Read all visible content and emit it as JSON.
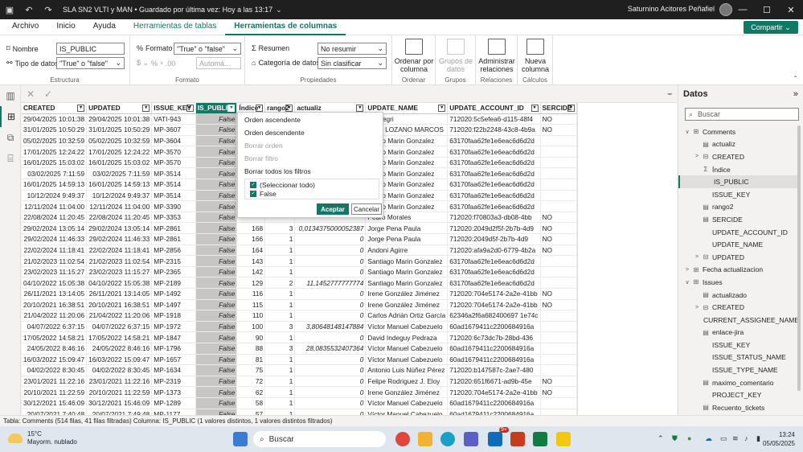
{
  "window": {
    "title": "SLA SN2 VLTI y MAN • Guardado por última vez: Hoy a las 13:17",
    "chevron": "⌄",
    "user": "Saturnino Acitores Peñafiel"
  },
  "menu": {
    "tabs": [
      "Archivo",
      "Inicio",
      "Ayuda"
    ],
    "ctx_tabs": [
      "Herramientas de tablas",
      "Herramientas de columnas"
    ],
    "active": "Herramientas de columnas",
    "share": "Compartir"
  },
  "ribbon": {
    "estructura": {
      "label": "Estructura",
      "name_label": "Nombre",
      "name_value": "IS_PUBLIC",
      "type_label": "Tipo de datos",
      "type_value": "\"True\" o \"false\""
    },
    "formato": {
      "label": "Formato",
      "format_label": "Formato",
      "format_value": "\"True\" o \"false\"",
      "auto": "Automá..."
    },
    "propiedades": {
      "label": "Propiedades",
      "summary_label": "Resumen",
      "summary_value": "No resumir",
      "category_label": "Categoría de datos",
      "category_value": "Sin clasificar"
    },
    "ordenar": {
      "label": "Ordenar",
      "btn": "Ordenar por columna"
    },
    "grupos": {
      "label": "Grupos",
      "btn": "Grupos de datos"
    },
    "relaciones": {
      "label": "Relaciones",
      "btn": "Administrar relaciones"
    },
    "calculos": {
      "label": "Cálculos",
      "btn": "Nueva columna"
    }
  },
  "table": {
    "columns": [
      "CREATED",
      "UPDATED",
      "ISSUE_KEY",
      "IS_PUBLIC",
      "Índice",
      "rango2",
      "actualiz",
      "UPDATE_NAME",
      "UPDATE_ACCOUNT_ID",
      "SERCIDE"
    ],
    "rows": [
      [
        "29/04/2025 10:01:38",
        "29/04/2025 10:01:38",
        "VATI-943",
        "False",
        "",
        "",
        "",
        "t-fpelegri",
        "712020:5c5efea6-d115-48f4",
        "NO"
      ],
      [
        "31/01/2025 10:50:29",
        "31/01/2025 10:50:29",
        "MP-3607",
        "False",
        "",
        "",
        "",
        "VIER LOZANO MARCOS",
        "712020:f22b2248-43c8-4b9a",
        "NO"
      ],
      [
        "05/02/2025 10:32:59",
        "05/02/2025 10:32:59",
        "MP-3604",
        "False",
        "",
        "",
        "",
        "ntiago Marin Gonzalez",
        "63170faa62fe1e6eac6d6d2d",
        ""
      ],
      [
        "17/01/2025 12:24:22",
        "17/01/2025 12:24:22",
        "MP-3570",
        "False",
        "",
        "",
        "",
        "ntiago Marin Gonzalez",
        "63170faa62fe1e6eac6d6d2d",
        ""
      ],
      [
        "16/01/2025 15:03:02",
        "16/01/2025 15:03:02",
        "MP-3570",
        "False",
        "",
        "",
        "",
        "ntiago Marin Gonzalez",
        "63170faa62fe1e6eac6d6d2d",
        ""
      ],
      [
        "03/02/2025 7:11:59",
        "03/02/2025 7:11:59",
        "MP-3514",
        "False",
        "",
        "",
        "",
        "ntiago Marin Gonzalez",
        "63170faa62fe1e6eac6d6d2d",
        ""
      ],
      [
        "16/01/2025 14:59:13",
        "16/01/2025 14:59:13",
        "MP-3514",
        "False",
        "",
        "",
        "",
        "ntiago Marin Gonzalez",
        "63170faa62fe1e6eac6d6d2d",
        ""
      ],
      [
        "10/12/2024 9:49:37",
        "10/12/2024 9:49:37",
        "MP-3514",
        "False",
        "",
        "",
        "",
        "ntiago Marin Gonzalez",
        "63170faa62fe1e6eac6d6d2d",
        ""
      ],
      [
        "12/11/2024 11:04:00",
        "12/11/2024 11:04:00",
        "MP-3390",
        "False",
        "",
        "",
        "",
        "ntiago Marin Gonzalez",
        "63170faa62fe1e6eac6d6d2d",
        ""
      ],
      [
        "22/08/2024 11:20:45",
        "22/08/2024 11:20:45",
        "MP-3353",
        "False",
        "",
        "",
        "",
        "Pedro Morales",
        "712020:f70803a3-db08-4bb",
        "NO"
      ],
      [
        "29/02/2024 13:05:14",
        "29/02/2024 13:05:14",
        "MP-2861",
        "False",
        "168",
        "3",
        "0,0134375000052387",
        "Jorge Pena Paula",
        "712020:2049d2f5f-2b7b-4d9",
        "NO"
      ],
      [
        "29/02/2024 11:46:33",
        "29/02/2024 11:46:33",
        "MP-2861",
        "False",
        "166",
        "1",
        "0",
        "Jorge Pena Paula",
        "712020:2049d5f-2b7b-4d9",
        "NO"
      ],
      [
        "22/02/2024 11:18:41",
        "22/02/2024 11:18:41",
        "MP-2856",
        "False",
        "164",
        "1",
        "0",
        "Andoni Agirre",
        "712020:afa9a2d0-6779-4b2a",
        "NO"
      ],
      [
        "21/02/2023 11:02:54",
        "21/02/2023 11:02:54",
        "MP-2315",
        "False",
        "143",
        "1",
        "0",
        "Santiago Marin Gonzalez",
        "63170faa62fe1e6eac6d6d2d",
        ""
      ],
      [
        "23/02/2023 11:15:27",
        "23/02/2023 11:15:27",
        "MP-2365",
        "False",
        "142",
        "1",
        "0",
        "Santiago Marin Gonzalez",
        "63170faa62fe1e6eac6d6d2d",
        ""
      ],
      [
        "04/10/2022 15:05:38",
        "04/10/2022 15:05:38",
        "MP-2189",
        "False",
        "129",
        "2",
        "11,1452777777774",
        "Santiago Marin Gonzalez",
        "63170faa62fe1e6eac6d6d2d",
        ""
      ],
      [
        "26/11/2021 13:14:05",
        "26/11/2021 13:14:05",
        "MP-1492",
        "False",
        "116",
        "1",
        "0",
        "Irene González Jiménez",
        "712020:704e5174-2a2e-41bb",
        "NO"
      ],
      [
        "20/10/2021 16:38:51",
        "20/10/2021 16:38:51",
        "MP-1497",
        "False",
        "115",
        "1",
        "0",
        "Irene González Jiménez",
        "712020:704e5174-2a2e-41bb",
        "NO"
      ],
      [
        "21/04/2022 11:20:06",
        "21/04/2022 11:20:06",
        "MP-1918",
        "False",
        "110",
        "1",
        "0",
        "Carlos Adrián Ortiz García",
        "62346a2f6a682400697 1e74c",
        ""
      ],
      [
        "04/07/2022 6:37:15",
        "04/07/2022 6:37:15",
        "MP-1972",
        "False",
        "100",
        "3",
        "3,80648148147884",
        "Víctor Manuel Cabezuelo",
        "60ad1679411c2200684916a",
        ""
      ],
      [
        "17/05/2022 14:58:21",
        "17/05/2022 14:58:21",
        "MP-1847",
        "False",
        "90",
        "1",
        "0",
        "David Indeguy Pedraza",
        "712020:6c73dc7b-28bd-436",
        ""
      ],
      [
        "24/05/2022 8:46:16",
        "24/05/2022 8:46:16",
        "MP-1796",
        "False",
        "88",
        "3",
        "28,0835532407364",
        "Víctor Manuel Cabezuelo",
        "60ad1679411c2200684916a",
        ""
      ],
      [
        "16/03/2022 15:09:47",
        "16/03/2022 15:09:47",
        "MP-1657",
        "False",
        "81",
        "1",
        "0",
        "Víctor Manuel Cabezuelo",
        "60ad1679411c2200684916a",
        ""
      ],
      [
        "04/02/2022 8:30:45",
        "04/02/2022 8:30:45",
        "MP-1634",
        "False",
        "75",
        "1",
        "0",
        "Antonio Luis Núñez Pérez",
        "712020:b147587c-2ae7-480",
        ""
      ],
      [
        "23/01/2021 11:22:16",
        "23/01/2021 11:22:16",
        "MP-2319",
        "False",
        "72",
        "1",
        "0",
        "Felipe Rodriguez J. Eloy",
        "712020:651f6671-ad9b-45e",
        "NO"
      ],
      [
        "20/10/2021 11:22:59",
        "20/10/2021 11:22:59",
        "MP-1373",
        "False",
        "62",
        "1",
        "0",
        "Irene González Jiménez",
        "712020:704e5174-2a2e-41bb",
        "NO"
      ],
      [
        "30/12/2021 15:46:09",
        "30/12/2021 15:46:09",
        "MP-1289",
        "False",
        "58",
        "1",
        "0",
        "Víctor Manuel Cabezuelo",
        "60ad1679411c2200684916a",
        ""
      ],
      [
        "20/07/2021 7:40:48",
        "20/07/2021 7:49:48",
        "MP-1177",
        "False",
        "57",
        "1",
        "0",
        "Víctor Manuel Cabezuelo",
        "60ad1679411c2200684916a",
        ""
      ]
    ]
  },
  "dropdown": {
    "sort_asc": "Orden ascendente",
    "sort_desc": "Orden descendente",
    "clear_sort": "Borrar orden",
    "clear_filter": "Borrar filtro",
    "clear_all": "Borrar todos los filtros",
    "select_all": "(Seleccionar todo)",
    "value_false": "False",
    "accept": "Aceptar",
    "cancel": "Cancelar"
  },
  "datapane": {
    "title": "Datos",
    "search_placeholder": "Buscar",
    "tree": [
      {
        "level": 0,
        "arrow": "∨",
        "icon": "table-icon",
        "label": "Comments"
      },
      {
        "level": 1,
        "arrow": "",
        "icon": "column-icon",
        "label": "actualiz"
      },
      {
        "level": 1,
        "arrow": ">",
        "icon": "hierarchy-icon",
        "label": "CREATED"
      },
      {
        "level": 1,
        "arrow": "",
        "icon": "sigma-icon",
        "label": "Índice"
      },
      {
        "level": 1,
        "arrow": "",
        "icon": "",
        "label": "IS_PUBLIC",
        "selected": true
      },
      {
        "level": 1,
        "arrow": "",
        "icon": "",
        "label": "ISSUE_KEY"
      },
      {
        "level": 1,
        "arrow": "",
        "icon": "column-icon",
        "label": "rango2"
      },
      {
        "level": 1,
        "arrow": "",
        "icon": "column-icon",
        "label": "SERCIDE"
      },
      {
        "level": 1,
        "arrow": "",
        "icon": "",
        "label": "UPDATE_ACCOUNT_ID"
      },
      {
        "level": 1,
        "arrow": "",
        "icon": "",
        "label": "UPDATE_NAME"
      },
      {
        "level": 1,
        "arrow": ">",
        "icon": "hierarchy-icon",
        "label": "UPDATED"
      },
      {
        "level": 0,
        "arrow": ">",
        "icon": "table-icon",
        "label": "Fecha actualizacion"
      },
      {
        "level": 0,
        "arrow": "∨",
        "icon": "table-icon",
        "label": "Issues"
      },
      {
        "level": 1,
        "arrow": "",
        "icon": "column-icon",
        "label": "actualizado"
      },
      {
        "level": 1,
        "arrow": ">",
        "icon": "hierarchy-icon",
        "label": "CREATED"
      },
      {
        "level": 1,
        "arrow": "",
        "icon": "",
        "label": "CURRENT_ASSIGNEE_NAME"
      },
      {
        "level": 1,
        "arrow": "",
        "icon": "column-icon",
        "label": "enlace-jira"
      },
      {
        "level": 1,
        "arrow": "",
        "icon": "",
        "label": "ISSUE_KEY"
      },
      {
        "level": 1,
        "arrow": "",
        "icon": "",
        "label": "ISSUE_STATUS_NAME"
      },
      {
        "level": 1,
        "arrow": "",
        "icon": "",
        "label": "ISSUE_TYPE_NAME"
      },
      {
        "level": 1,
        "arrow": "",
        "icon": "column-icon",
        "label": "maximo_comentario"
      },
      {
        "level": 1,
        "arrow": "",
        "icon": "",
        "label": "PROJECT_KEY"
      },
      {
        "level": 1,
        "arrow": "",
        "icon": "column-icon",
        "label": "Recuento_tickets"
      }
    ]
  },
  "status": "Tabla: Comments (514 filas, 41 filas filtradas) Columna: IS_PUBLIC (1 valores distintos, 1 valores distintos filtrados)",
  "taskbar": {
    "temp": "15°C",
    "weather": "Mayorm. nublado",
    "search": "Buscar",
    "badge": "9+",
    "time": "13:24",
    "date": "05/05/2025"
  }
}
